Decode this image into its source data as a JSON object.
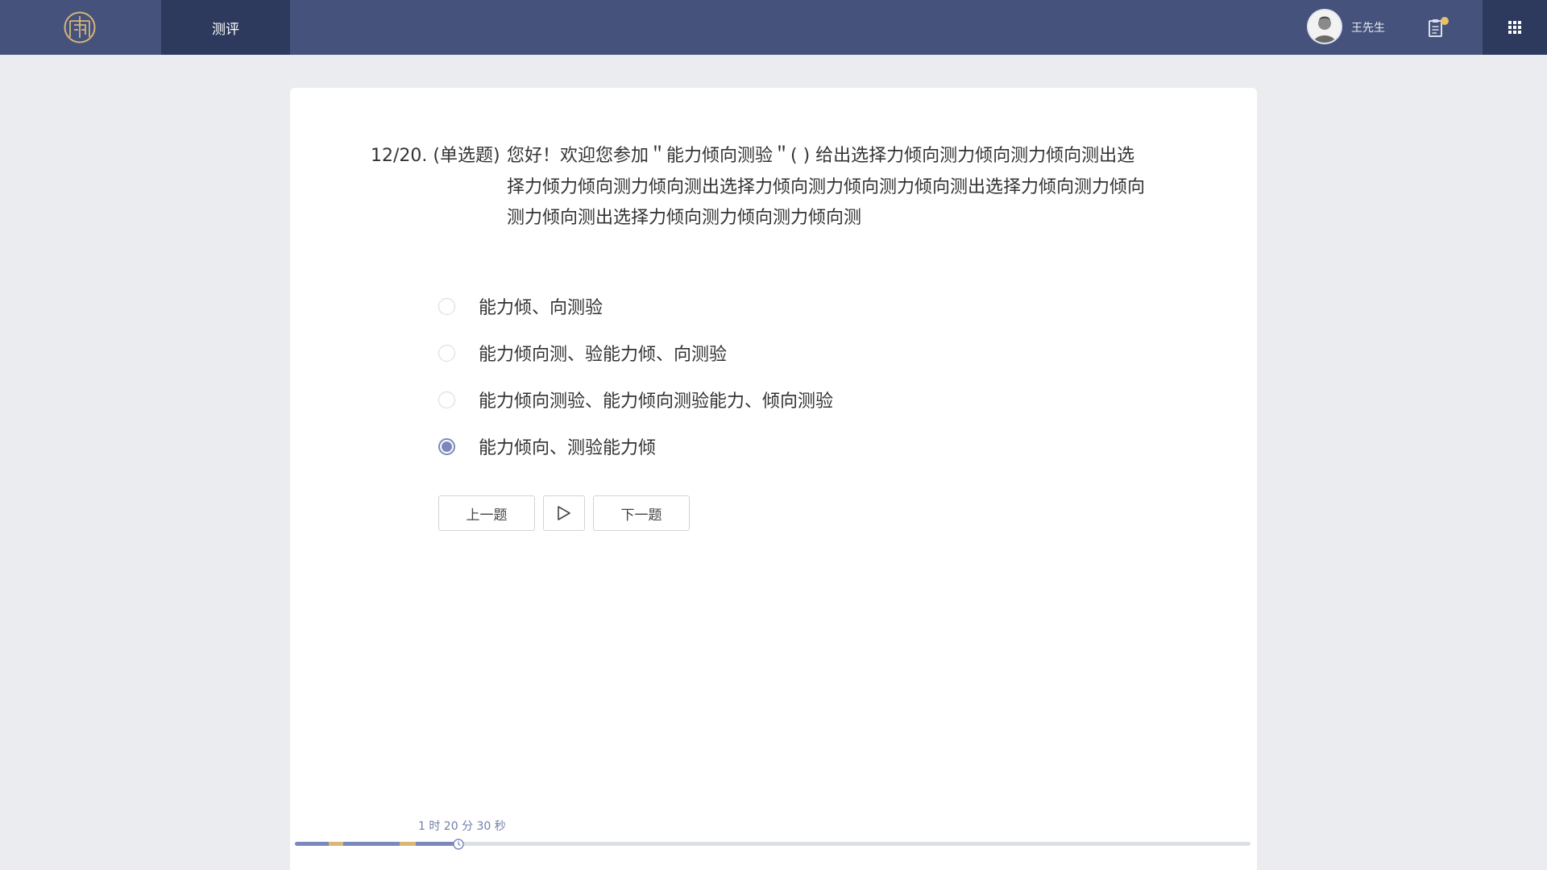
{
  "header": {
    "logo_icon": "ornamental-emblem-icon",
    "nav_tab_label": "测评",
    "user_name": "王先生",
    "clipboard_icon": "clipboard-icon",
    "apps_icon": "grid-apps-icon",
    "colors": {
      "bar": "#45527c",
      "active_tab": "#2d3a5e",
      "badge": "#e7c06a",
      "logo": "#d5b57a"
    }
  },
  "question": {
    "prefix": "12/20. (单选题)",
    "text": "您好！欢迎您参加＂能力倾向测验＂( ) 给出选择力倾向测力倾向测力倾向测出选择力倾力倾向测力倾向测出选择力倾向测力倾向测力倾向测出选择力倾向测力倾向测力倾向测出选择力倾向测力倾向测力倾向测",
    "options": [
      {
        "label": "能力倾、向测验",
        "selected": false
      },
      {
        "label": "能力倾向测、验能力倾、向测验",
        "selected": false
      },
      {
        "label": "能力倾向测验、能力倾向测验能力、倾向测验",
        "selected": false
      },
      {
        "label": "能力倾向、测验能力倾",
        "selected": true
      }
    ],
    "accent_color": "#7b88bc"
  },
  "controls": {
    "prev_label": "上一题",
    "play_icon": "play-icon",
    "next_label": "下一题"
  },
  "timeline": {
    "elapsed_label": "1 时 20 分 30 秒",
    "clock_icon": "clock-icon",
    "progress_fraction": 0.17,
    "segment_colors": [
      "#7b88bc",
      "#d9b877",
      "#7b88bc",
      "#d9b877",
      "#7b88bc"
    ]
  }
}
